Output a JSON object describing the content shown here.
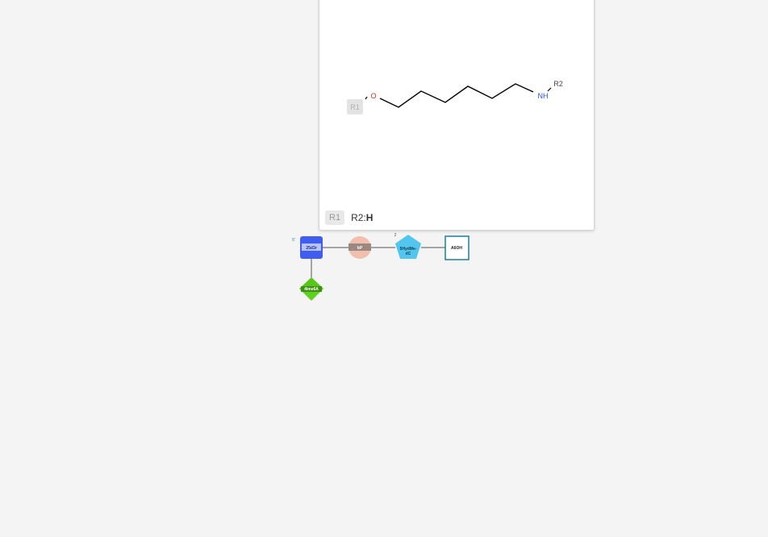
{
  "structure": {
    "atom_o": "O",
    "atom_nh": "NH",
    "rgroup_r1": "R1",
    "rgroup_r2": "R2"
  },
  "rgroup_bar": {
    "r1_chip": "R1",
    "r2_prefix": "R2:",
    "r2_value": "H"
  },
  "sequence": {
    "five_prime_label": "5'",
    "position_label": "2",
    "nodes": {
      "sugar": "25d3r",
      "phosphate": "bP",
      "base_pentagon": "5HydMe-dC",
      "base_pentagon_line1": "5HydMe-",
      "base_pentagon_line2": "dC",
      "terminal": "A6OH",
      "branch_base": "4ime6A"
    },
    "colors": {
      "sugar": "#3f5ef0",
      "phosphate": "#f2bfae",
      "base_pentagon": "#52c6ee",
      "terminal_border": "#1b7e9b",
      "branch_base": "#5ed21f"
    }
  }
}
